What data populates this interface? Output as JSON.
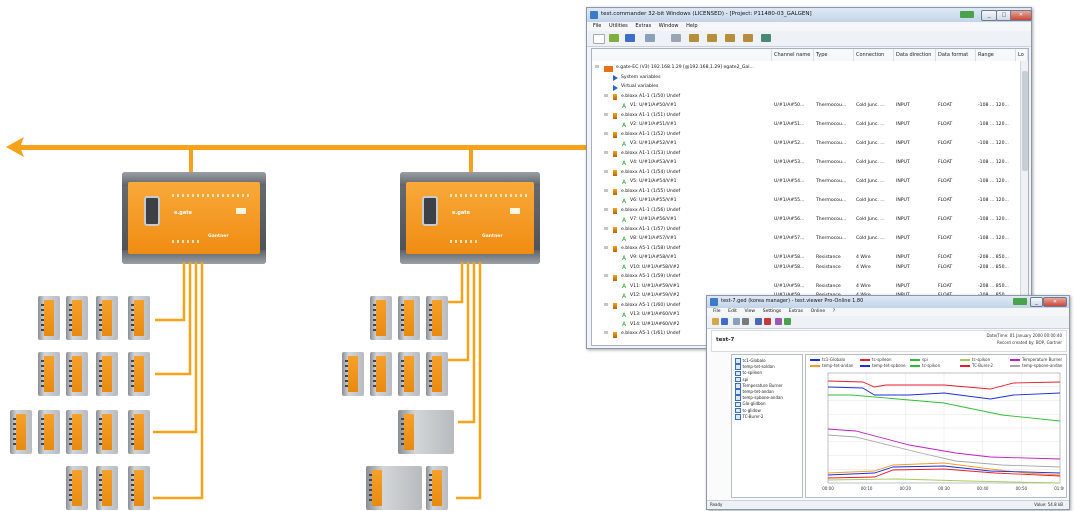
{
  "tc_window": {
    "title": "test.commander 32-bit Windows (LICENSED) - [Project: P11480-03_GALGEN]",
    "menu": [
      "File",
      "Utilities",
      "Extras",
      "Window",
      "Help"
    ],
    "columns": [
      "Channel name",
      "Type",
      "Connection",
      "Data direction",
      "Data format",
      "Range",
      "Lo"
    ],
    "tree": [
      {
        "text": "e.gate-EC (V3) 192.168.1.29 [@192.168.1.29] egate2_Gal...",
        "level": 0,
        "icon": "gateway-icon"
      },
      {
        "text": "System variables",
        "level": 1,
        "icon": "triangle-icon"
      },
      {
        "text": "Virtual variables",
        "level": 1,
        "icon": "triangle-icon"
      },
      {
        "text": "e.bloxx A1-1 (1/50) Undef",
        "level": 1,
        "icon": "module-icon"
      },
      {
        "text": "V1: U/#1/A#50/V#1",
        "level": 2,
        "icon": "channel-icon",
        "row": [
          "U/#1/A#50...",
          "Thermocou...",
          "Cold Junc. ...",
          "INPUT",
          "FLOAT",
          "-108 ... 120..."
        ]
      },
      {
        "text": "e.bloxx A1-1 (1/51) Undef",
        "level": 1,
        "icon": "module-icon"
      },
      {
        "text": "V2: U/#1/A#51/V#1",
        "level": 2,
        "icon": "channel-icon",
        "row": [
          "U/#1/A#51...",
          "Thermocou...",
          "Cold Junc. ...",
          "INPUT",
          "FLOAT",
          "-108 ... 120..."
        ]
      },
      {
        "text": "e.bloxx A1-1 (1/52) Undef",
        "level": 1,
        "icon": "module-icon"
      },
      {
        "text": "V3: U/#1/A#52/V#1",
        "level": 2,
        "icon": "channel-icon",
        "row": [
          "U/#1/A#52...",
          "Thermocou...",
          "Cold Junc. ...",
          "INPUT",
          "FLOAT",
          "-108 ... 120..."
        ]
      },
      {
        "text": "e.bloxx A1-1 (1/53) Undef",
        "level": 1,
        "icon": "module-icon"
      },
      {
        "text": "V4: U/#1/A#53/V#1",
        "level": 2,
        "icon": "channel-icon",
        "row": [
          "U/#1/A#53...",
          "Thermocou...",
          "Cold Junc. ...",
          "INPUT",
          "FLOAT",
          "-108 ... 120..."
        ]
      },
      {
        "text": "e.bloxx A1-1 (1/54) Undef",
        "level": 1,
        "icon": "module-icon"
      },
      {
        "text": "V5: U/#1/A#54/V#1",
        "level": 2,
        "icon": "channel-icon",
        "row": [
          "U/#1/A#54...",
          "Thermocou...",
          "Cold Junc. ...",
          "INPUT",
          "FLOAT",
          "-108 ... 120..."
        ]
      },
      {
        "text": "e.bloxx A1-1 (1/55) Undef",
        "level": 1,
        "icon": "module-icon"
      },
      {
        "text": "V6: U/#1/A#55/V#1",
        "level": 2,
        "icon": "channel-icon",
        "row": [
          "U/#1/A#55...",
          "Thermocou...",
          "Cold Junc. ...",
          "INPUT",
          "FLOAT",
          "-108 ... 120..."
        ]
      },
      {
        "text": "e.bloxx A1-1 (1/56) Undef",
        "level": 1,
        "icon": "module-icon"
      },
      {
        "text": "V7: U/#1/A#56/V#1",
        "level": 2,
        "icon": "channel-icon",
        "row": [
          "U/#1/A#56...",
          "Thermocou...",
          "Cold Junc. ...",
          "INPUT",
          "FLOAT",
          "-108 ... 120..."
        ]
      },
      {
        "text": "e.bloxx A1-1 (1/57) Undef",
        "level": 1,
        "icon": "module-icon"
      },
      {
        "text": "V8: U/#1/A#57/V#1",
        "level": 2,
        "icon": "channel-icon",
        "row": [
          "U/#1/A#57...",
          "Thermocou...",
          "Cold Junc. ...",
          "INPUT",
          "FLOAT",
          "-108 ... 120..."
        ]
      },
      {
        "text": "e.bloxx A5-1 (1/58) Undef",
        "level": 1,
        "icon": "module-icon"
      },
      {
        "text": "V9: U/#1/A#58/V#1",
        "level": 2,
        "icon": "channel-icon",
        "row": [
          "U/#1/A#58...",
          "Resistance",
          "4 Wire",
          "INPUT",
          "FLOAT",
          "-208 ... 850..."
        ]
      },
      {
        "text": "V10: U/#1/A#58/V#2",
        "level": 2,
        "icon": "channel-icon",
        "row": [
          "U/#1/A#58...",
          "Resistance",
          "4 Wire",
          "INPUT",
          "FLOAT",
          "-208 ... 850..."
        ]
      },
      {
        "text": "e.bloxx A5-1 (1/59) Undef",
        "level": 1,
        "icon": "module-icon"
      },
      {
        "text": "V11: U/#1/A#59/V#1",
        "level": 2,
        "icon": "channel-icon",
        "row": [
          "U/#1/A#59...",
          "Resistance",
          "4 Wire",
          "INPUT",
          "FLOAT",
          "-208 ... 850..."
        ]
      },
      {
        "text": "V12: U/#1/A#59/V#2",
        "level": 2,
        "icon": "channel-icon",
        "row": [
          "U/#1/A#59...",
          "Resistance",
          "4 Wire",
          "INPUT",
          "FLOAT",
          "-208 ... 850..."
        ]
      },
      {
        "text": "e.bloxx A5-1 (1/60) Undef",
        "level": 1,
        "icon": "module-icon"
      },
      {
        "text": "V13: U/#1/A#60/V#1",
        "level": 2,
        "icon": "channel-icon",
        "row": [
          "",
          "",
          "",
          "",
          "",
          ""
        ]
      },
      {
        "text": "V14: U/#1/A#60/V#2",
        "level": 2,
        "icon": "channel-icon",
        "row": [
          "",
          "",
          "",
          "",
          "",
          ""
        ]
      },
      {
        "text": "e.bloxx A5-1 (1/61) Undef",
        "level": 1,
        "icon": "module-icon"
      }
    ]
  },
  "tv_window": {
    "title": "test-7.ged (korea manager) - test.viewer Pro-Online 1.80",
    "menu": [
      "File",
      "Edit",
      "View",
      "Settings",
      "Extras",
      "Online",
      "?"
    ],
    "doc_label": "test-7",
    "datetime_text": "Date/Time: 01 January 2000 00:00:40",
    "record_text": "Record created by: BOP, Gartner",
    "channels": [
      "tc1-Globalo",
      "temp-tet-soldan",
      "tc-spileon",
      "spi",
      "Temperature Burner",
      "temp-tet-andan",
      "temp-spbone-andan",
      "Glo-glidbon",
      "tc-glidow",
      "TC-Burer-2"
    ],
    "legend": [
      {
        "label": "tc1-Globalo",
        "color": "#1c2fd8"
      },
      {
        "label": "tc-spileon",
        "color": "#e81e2c"
      },
      {
        "label": "spi",
        "color": "#2fbf34"
      },
      {
        "label": "tc-spikon",
        "color": "#a9c95a"
      },
      {
        "label": "Temperature Burner",
        "color": "#c01fc2"
      },
      {
        "label": "temp-tet-andan",
        "color": "#f49b29"
      },
      {
        "label": "temp-tet-spbone",
        "color": "#1c2fd8"
      },
      {
        "label": "tc-spikon",
        "color": "#2fbf34"
      },
      {
        "label": "TC-Burer-2",
        "color": "#e81e2c"
      },
      {
        "label": "temp-spbone-andan",
        "color": "#a8a8a8"
      }
    ],
    "x_ticks": [
      "00:00",
      "00:10",
      "00:20",
      "00:30",
      "00:40",
      "00:50",
      "01:00"
    ],
    "status_left": "Ready",
    "status_right": "Value: 54.8 kB"
  },
  "icons": {
    "bus_arrow": "left-arrow-icon",
    "controller_logo": "e.gate"
  },
  "colors": {
    "orange": "#f7a21b",
    "win_border": "#8c98a8"
  }
}
